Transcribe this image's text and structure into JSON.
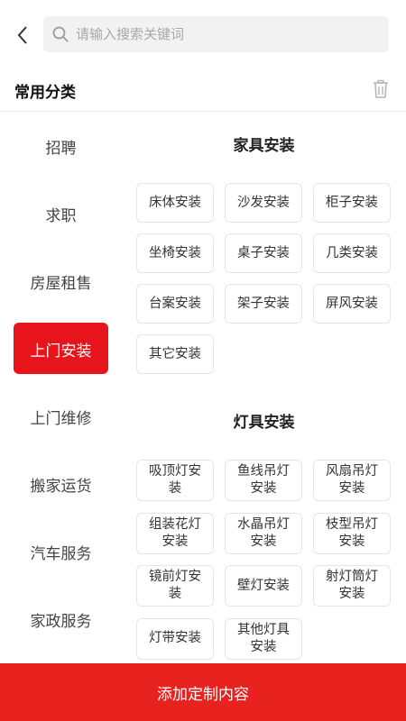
{
  "search": {
    "placeholder": "请输入搜索关键词",
    "value": ""
  },
  "header": {
    "title": "常用分类"
  },
  "sidebar": {
    "items": [
      {
        "label": "招聘",
        "active": false
      },
      {
        "label": "求职",
        "active": false
      },
      {
        "label": "房屋租售",
        "active": false
      },
      {
        "label": "上门安装",
        "active": true
      },
      {
        "label": "上门维修",
        "active": false
      },
      {
        "label": "搬家运货",
        "active": false
      },
      {
        "label": "汽车服务",
        "active": false
      },
      {
        "label": "家政服务",
        "active": false
      }
    ]
  },
  "groups": [
    {
      "title": "家具安装",
      "items": [
        "床体安装",
        "沙发安装",
        "柜子安装",
        "坐椅安装",
        "桌子安装",
        "几类安装",
        "台案安装",
        "架子安装",
        "屏风安装",
        "其它安装"
      ]
    },
    {
      "title": "灯具安装",
      "items": [
        "吸顶灯安装",
        "鱼线吊灯安装",
        "风扇吊灯安装",
        "组装花灯安装",
        "水晶吊灯安装",
        "枝型吊灯安装",
        "镜前灯安装",
        "壁灯安装",
        "射灯筒灯安装",
        "灯带安装",
        "其他灯具安装"
      ]
    }
  ],
  "footer": {
    "button_label": "添加定制内容"
  },
  "colors": {
    "accent": "#e8141c",
    "bottom_bar": "#e8231f",
    "search_bg": "#f2f2f2"
  }
}
